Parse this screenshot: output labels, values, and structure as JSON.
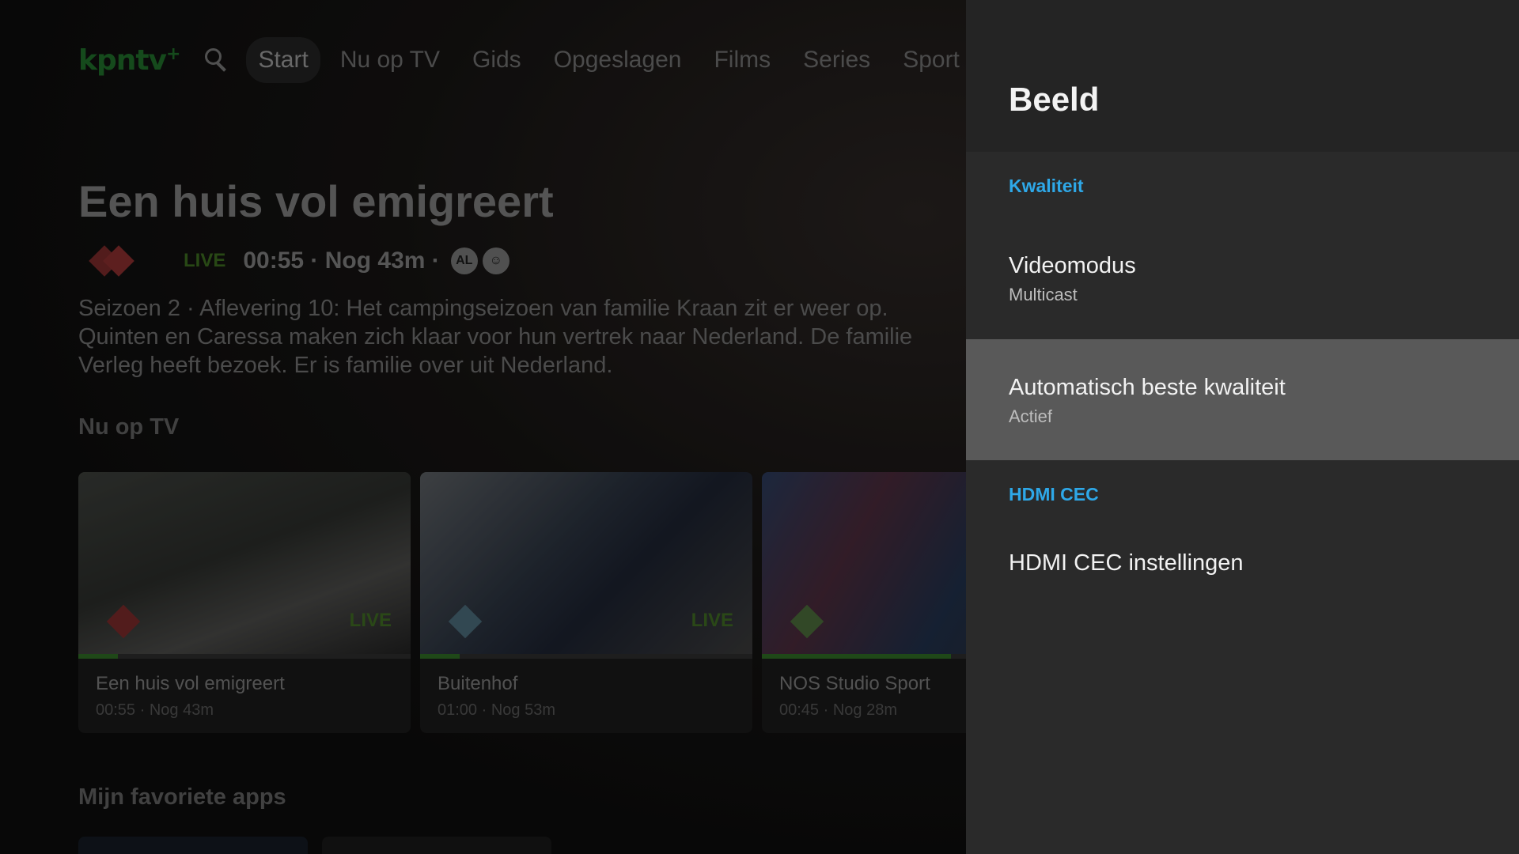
{
  "nav": {
    "logo": "kpntv",
    "logo_plus": "+",
    "items": [
      "Start",
      "Nu op TV",
      "Gids",
      "Opgeslagen",
      "Films",
      "Series",
      "Sport"
    ],
    "active_index": 0
  },
  "hero": {
    "title": "Een huis vol emigreert",
    "live_label": "LIVE",
    "time_info": "00:55 · Nog 43m ·",
    "rating_label": "AL",
    "description_lines": [
      "Seizoen 2 · Aflevering 10: Het campingseizoen van familie Kraan zit er weer op.",
      "Quinten en Caressa maken zich klaar voor hun vertrek naar Nederland. De familie",
      "Verleg heeft bezoek. Er is familie over uit Nederland."
    ]
  },
  "now_on_tv": {
    "heading": "Nu op TV",
    "cards": [
      {
        "title": "Een huis vol emigreert",
        "subtitle": "00:55 · Nog 43m",
        "live": "LIVE",
        "channel": "NPO 1",
        "progress": 0.12
      },
      {
        "title": "Buitenhof",
        "subtitle": "01:00 · Nog 53m",
        "live": "LIVE",
        "channel": "NPO 2",
        "progress": 0.12
      },
      {
        "title": "NOS Studio Sport",
        "subtitle": "00:45 · Nog 28m",
        "live": "",
        "channel": "NPO 3",
        "progress": 0.57
      }
    ]
  },
  "apps": {
    "heading": "Mijn favoriete apps"
  },
  "settings": {
    "title": "Beeld",
    "categories": {
      "quality": "Kwaliteit",
      "hdmi": "HDMI CEC"
    },
    "items": [
      {
        "title": "Videomodus",
        "subtitle": "Multicast"
      },
      {
        "title": "Automatisch beste kwaliteit",
        "subtitle": "Actief"
      },
      {
        "title": "HDMI CEC instellingen",
        "subtitle": ""
      }
    ],
    "focused_index": 1
  },
  "colors": {
    "accent_blue": "#2ea8e8",
    "kpn_green": "#1f6e2a",
    "live_green": "#3c6a1f",
    "panel_bg": "#2a2a2a",
    "focus_bg": "#595959"
  }
}
